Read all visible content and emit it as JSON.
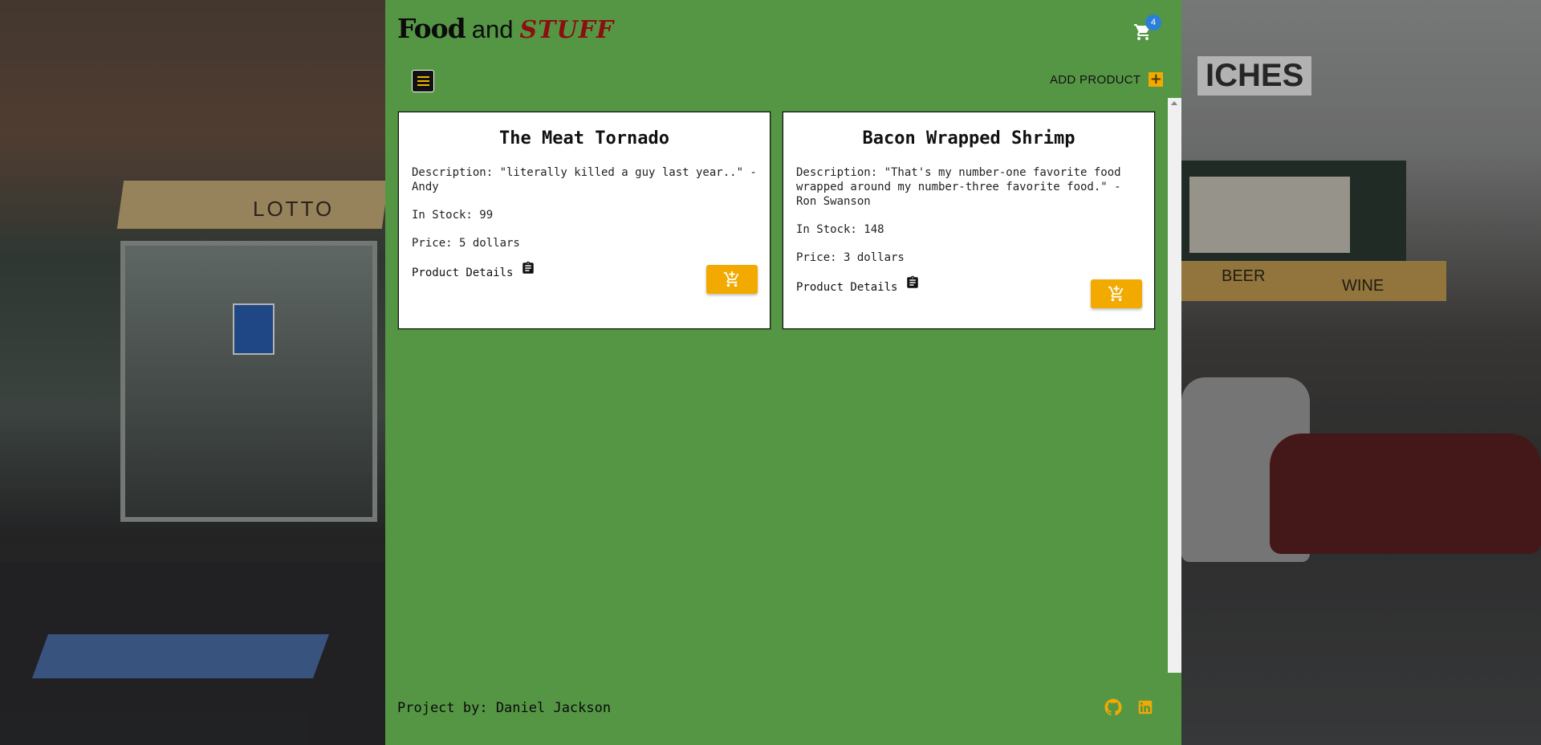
{
  "header": {
    "brand_food": "Food",
    "brand_and": "and",
    "brand_stuff": "STUFF",
    "cart_count": "4"
  },
  "toolbar": {
    "add_product_label": "ADD PRODUCT",
    "add_product_symbol": "+"
  },
  "products": [
    {
      "name": "The Meat Tornado",
      "description": "Description: \"literally killed a guy last year..\" - Andy",
      "stock": "In Stock: 99",
      "price": "Price: 5 dollars",
      "details_label": "Product Details"
    },
    {
      "name": "Bacon Wrapped Shrimp",
      "description": "Description: \"That's my number-one favorite food wrapped around my number-three favorite food.\" - Ron Swanson",
      "stock": "In Stock: 148",
      "price": "Price: 3 dollars",
      "details_label": "Product Details"
    }
  ],
  "footer": {
    "credit": "Project by: Daniel Jackson",
    "icons": [
      "github-icon",
      "linkedin-icon"
    ]
  },
  "background_signs": {
    "lotto": "LOTTO",
    "ches": "ICHES",
    "beer": "BEER",
    "wine": "WINE"
  },
  "colors": {
    "panel_green": "#559645",
    "accent_orange": "#f2a900",
    "badge_blue": "#2c7fd9",
    "stuff_red": "#8b0f0f"
  }
}
